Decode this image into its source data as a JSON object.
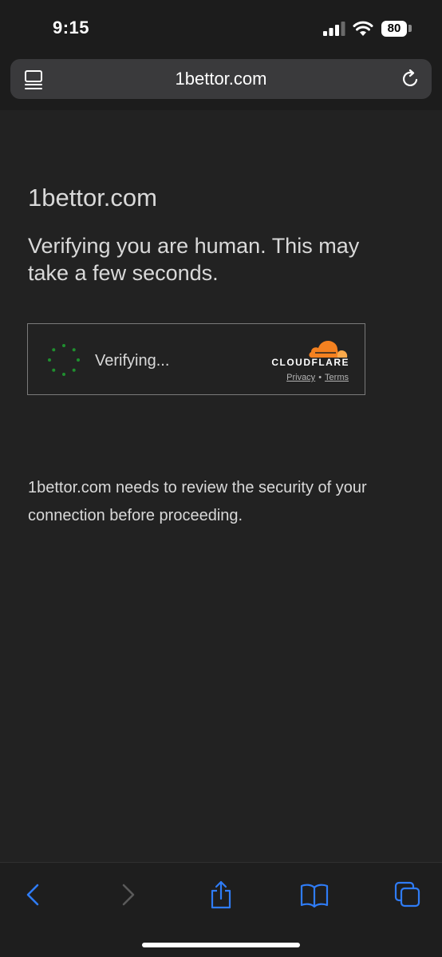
{
  "status_bar": {
    "time": "9:15",
    "battery": "80"
  },
  "address_bar": {
    "url": "1bettor.com"
  },
  "content": {
    "site_title": "1bettor.com",
    "heading": "Verifying you are human. This may take a few seconds.",
    "review_text": "1bettor.com needs to review the security of your connection before proceeding."
  },
  "widget": {
    "status": "Verifying...",
    "brand": "CLOUDFLARE",
    "privacy": "Privacy",
    "separator": "•",
    "terms": "Terms"
  },
  "toolbar": {
    "items": [
      {
        "icon": "back-chevron-icon"
      },
      {
        "icon": "forward-chevron-icon"
      },
      {
        "icon": "share-icon"
      },
      {
        "icon": "bookmarks-icon"
      },
      {
        "icon": "tabs-icon"
      }
    ]
  },
  "colors": {
    "background": "#222222",
    "text": "#d9d9d9",
    "accent_blue": "#2f7cf6",
    "cloudflare_orange": "#f48120",
    "spinner_green": "#1f8f2f"
  }
}
